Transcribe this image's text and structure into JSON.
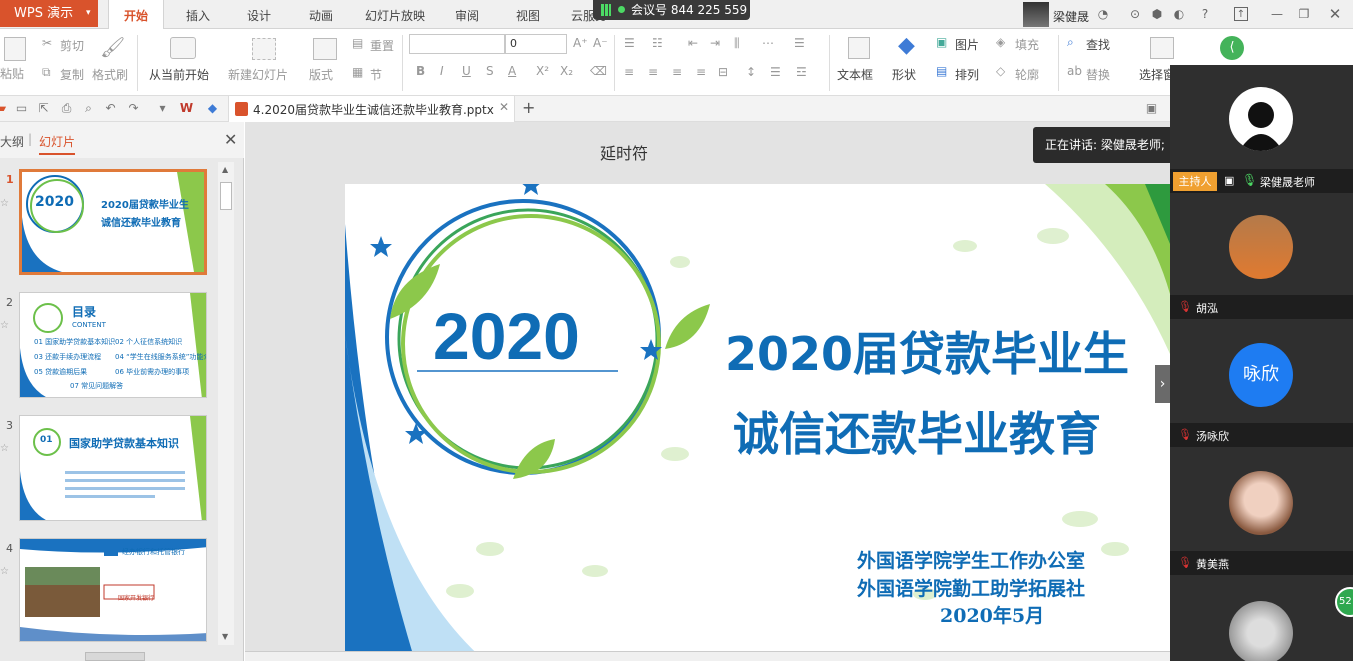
{
  "app": {
    "menu_label": "WPS 演示"
  },
  "tabs": [
    "开始",
    "插入",
    "设计",
    "动画",
    "幻灯片放映",
    "审阅",
    "视图",
    "云服务"
  ],
  "meeting": {
    "label": "会议号 844 225 559"
  },
  "user": {
    "name": "梁健晟"
  },
  "ribbon": {
    "paste": "粘贴",
    "cut": "剪切",
    "copy": "复制",
    "format_painter": "格式刷",
    "from_current": "从当前开始",
    "new_slide": "新建幻灯片",
    "layout": "版式",
    "section": "节",
    "reset": "重置",
    "font_size": "0",
    "textbox": "文本框",
    "shape": "形状",
    "picture": "图片",
    "arrange": "排列",
    "fill": "填充",
    "outline": "轮廓",
    "find": "查找",
    "replace": "替换",
    "select": "选择窗"
  },
  "document": {
    "tab_name": "4.2020届贷款毕业生诚信还款毕业教育.pptx"
  },
  "panel": {
    "outline_tab": "大纲",
    "slides_tab": "幻灯片"
  },
  "thumbnails": [
    {
      "num": "1",
      "year": "2020",
      "title1": "2020届贷款毕业生",
      "title2": "诚信还款毕业教育"
    },
    {
      "num": "2",
      "title": "目录",
      "sub": "CONTENT",
      "items": [
        "01 国家助学贷款基本知识",
        "02 个人征信系统知识",
        "03 还款手续办理流程",
        "04 “学生在线服务系统”功能介绍",
        "05 贷款逾期后果",
        "06 毕业前需办理的事项",
        "07 常见问题解答"
      ]
    },
    {
      "num": "3",
      "badge": "01",
      "title": "国家助学贷款基本知识"
    },
    {
      "num": "4",
      "bank": "国家开发银行",
      "header": "经办银行和托管银行"
    }
  ],
  "slide": {
    "placeholder": "延时符",
    "year": "2020",
    "title_line1": "2020届贷款毕业生",
    "title_line2": "诚信还款毕业教育",
    "org1": "外国语学院学生工作办公室",
    "org2": "外国语学院勤工助学拓展社",
    "date": "2020年5月"
  },
  "meeting_panel": {
    "speaking": "正在讲话: 梁健晟老师;",
    "host_badge": "主持人",
    "participants": [
      {
        "name": "梁健晟老师",
        "avatar_text": ""
      },
      {
        "name": "胡泓",
        "avatar_text": ""
      },
      {
        "name": "汤咏欣",
        "avatar_text": "咏欣"
      },
      {
        "name": "黄美燕",
        "avatar_text": ""
      },
      {
        "name": "",
        "avatar_text": ""
      }
    ],
    "fab_text": "52"
  },
  "colors": {
    "brand": "#d9532c",
    "title_blue": "#0f6cb5",
    "green": "#6cc04a"
  }
}
